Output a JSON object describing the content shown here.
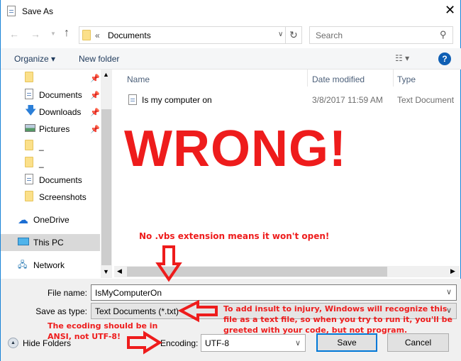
{
  "title": "Save As",
  "address": {
    "prefix": "«",
    "path": "Documents"
  },
  "search": {
    "placeholder": "Search"
  },
  "toolbar": {
    "organize": "Organize",
    "new_folder": "New folder"
  },
  "sidebar": {
    "items": [
      {
        "label": "",
        "icon": "folder-icon",
        "pinned": true
      },
      {
        "label": "Documents",
        "icon": "document-icon",
        "pinned": true
      },
      {
        "label": "Downloads",
        "icon": "download-icon",
        "pinned": true
      },
      {
        "label": "Pictures",
        "icon": "pictures-icon",
        "pinned": true
      },
      {
        "label": "_",
        "icon": "folder-icon"
      },
      {
        "label": "_",
        "icon": "folder-icon"
      },
      {
        "label": "Documents",
        "icon": "document-icon"
      },
      {
        "label": "Screenshots",
        "icon": "folder-icon"
      },
      {
        "label": "OneDrive",
        "icon": "onedrive-icon"
      },
      {
        "label": "This PC",
        "icon": "computer-icon",
        "selected": true
      },
      {
        "label": "Network",
        "icon": "network-icon"
      }
    ]
  },
  "columns": [
    "Name",
    "Date modified",
    "Type"
  ],
  "files": [
    {
      "name": "Is my computer on",
      "date": "3/8/2017 11:59 AM",
      "type": "Text Document"
    }
  ],
  "form": {
    "file_name_label": "File name:",
    "file_name": "IsMyComputerOn",
    "type_label": "Save as type:",
    "type": "Text Documents (*.txt)",
    "encoding_label": "Encoding:",
    "encoding": "UTF-8",
    "save": "Save",
    "cancel": "Cancel",
    "hide_folders": "Hide Folders"
  },
  "annotations": {
    "wrong": "WRONG!",
    "vbs": "No .vbs extension means it won't open!",
    "insult": [
      "To add insult to injury, Windows will recognize this",
      "file as a text file, so when you try to run it, you'll be",
      "greeted with your code, but not program."
    ],
    "encoding": [
      "The ecoding should be in",
      "ANSI, not UTF-8!"
    ],
    "color": "#ee1c1c"
  },
  "colors": {
    "accent": "#1883d7",
    "selected": "#d9d9d9"
  }
}
